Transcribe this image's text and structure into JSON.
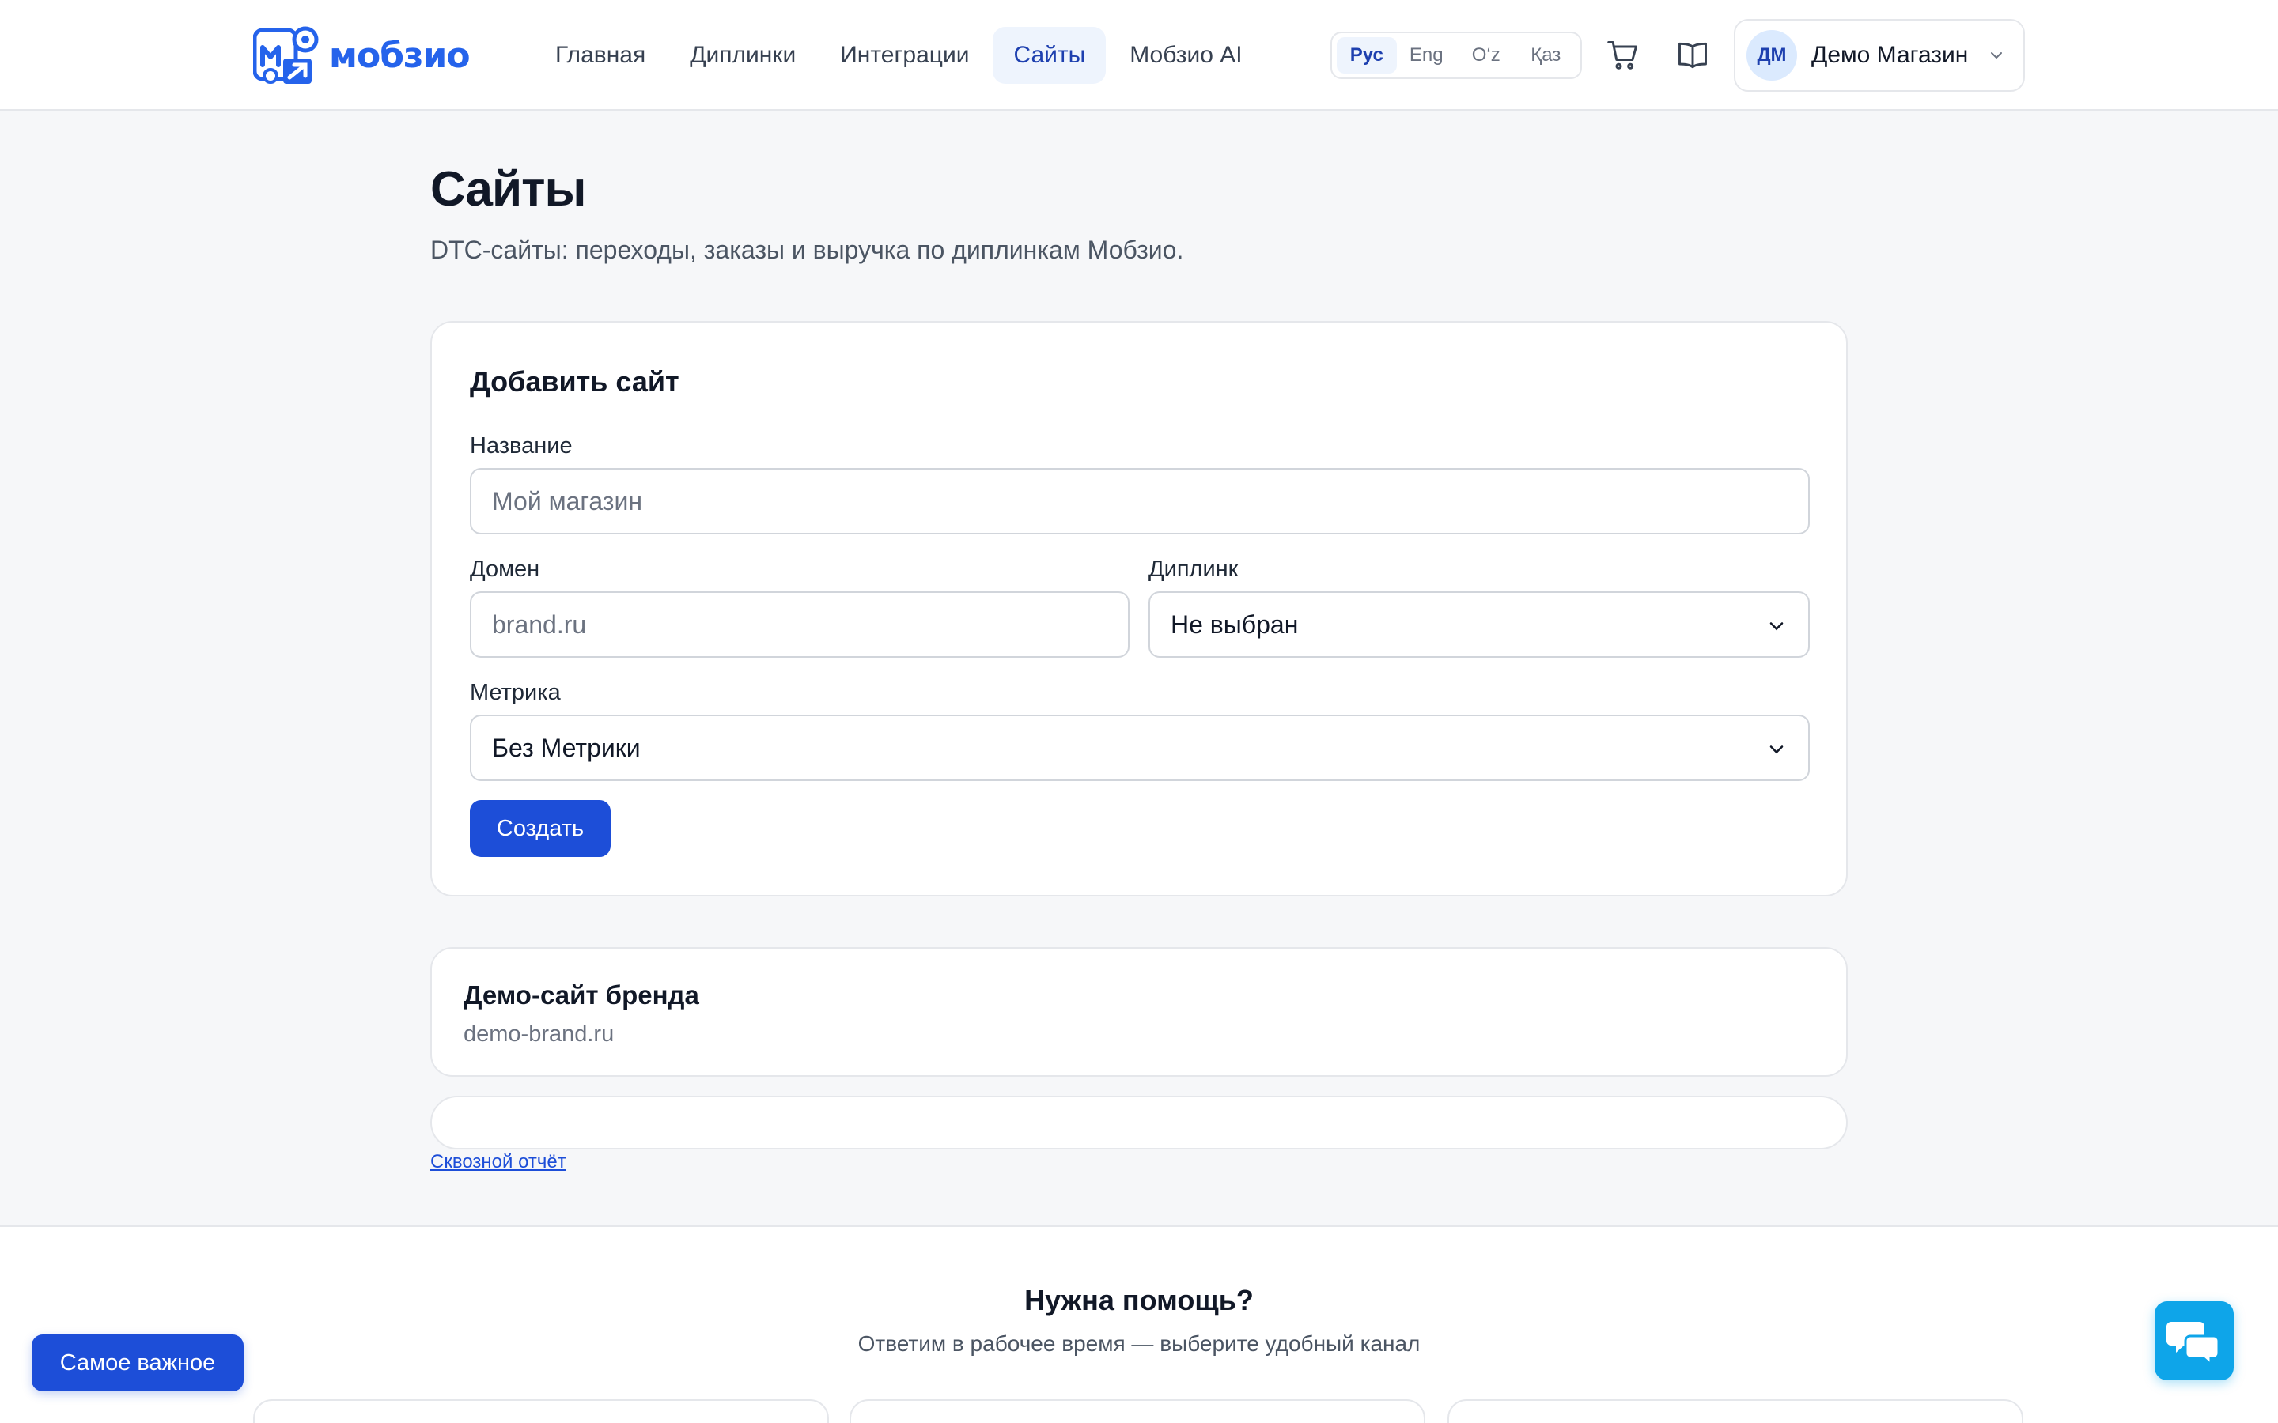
{
  "header": {
    "logo_text": "мобзио",
    "nav": [
      {
        "label": "Главная",
        "active": false
      },
      {
        "label": "Диплинки",
        "active": false
      },
      {
        "label": "Интеграции",
        "active": false
      },
      {
        "label": "Сайты",
        "active": true
      },
      {
        "label": "Мобзио AI",
        "active": false
      }
    ],
    "languages": [
      {
        "label": "Рус",
        "active": true
      },
      {
        "label": "Eng",
        "active": false
      },
      {
        "label": "O‘z",
        "active": false
      },
      {
        "label": "Қаз",
        "active": false
      }
    ],
    "cart_icon": "cart-icon",
    "docs_icon": "book-icon",
    "account": {
      "initials": "ДМ",
      "name": "Демо Магазин"
    }
  },
  "page": {
    "title": "Сайты",
    "subtitle": "DTC-сайты: переходы, заказы и выручка по диплинкам Мобзио."
  },
  "form": {
    "title": "Добавить сайт",
    "name_label": "Название",
    "name_placeholder": "Мой магазин",
    "domain_label": "Домен",
    "domain_placeholder": "brand.ru",
    "deeplink_label": "Диплинк",
    "deeplink_value": "Не выбран",
    "metrika_label": "Метрика",
    "metrika_value": "Без Метрики",
    "submit_label": "Создать"
  },
  "sites": [
    {
      "name": "Демо-сайт бренда",
      "domain": "demo-brand.ru"
    }
  ],
  "report_link": "Сквозной отчёт",
  "footer": {
    "help_title": "Нужна помощь?",
    "help_subtitle": "Ответим в рабочее время — выберите удобный канал"
  },
  "floating": {
    "important_label": "Самое важное",
    "chat_icon": "chat-icon"
  },
  "colors": {
    "accent": "#1d4ed8",
    "brand": "#2563eb",
    "active_nav_bg": "#eef4fd",
    "chat": "#0ea5e9",
    "background": "#f6f7f9"
  }
}
